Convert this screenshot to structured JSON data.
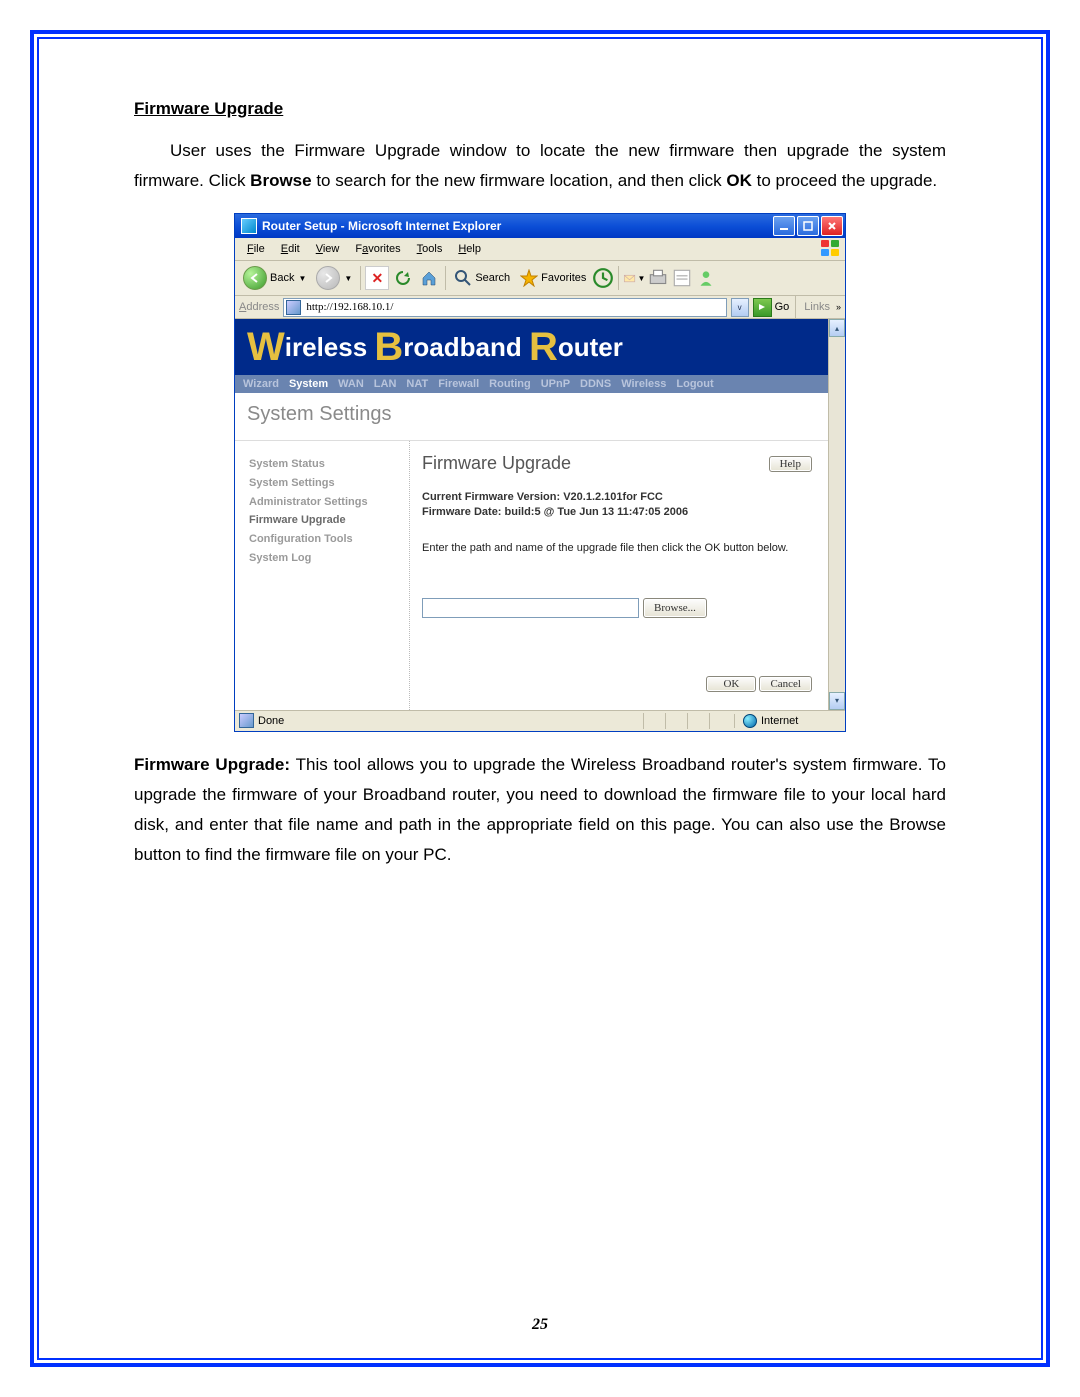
{
  "doc": {
    "section_title": "Firmware Upgrade",
    "para1_a": "User uses the Firmware Upgrade window to locate the new firmware then upgrade the system firmware. Click ",
    "para1_b": "Browse",
    "para1_c": " to search for the new firmware location, and then click ",
    "para1_d": "OK",
    "para1_e": " to proceed the upgrade.",
    "para2_a": "Firmware Upgrade:",
    "para2_b": " This tool allows you to upgrade the Wireless Broadband router's system firmware. To upgrade the firmware of your Broadband router, you need to download the firmware file to your local hard disk, and enter that file name and path in the appropriate field on this page. You can also use the Browse button to find the firmware file on your PC.",
    "page_number": "25"
  },
  "browser": {
    "title": "Router Setup - Microsoft Internet Explorer",
    "menus": [
      "File",
      "Edit",
      "View",
      "Favorites",
      "Tools",
      "Help"
    ],
    "menu_accelerators": [
      "F",
      "E",
      "V",
      "a",
      "T",
      "H"
    ],
    "back": "Back",
    "search": "Search",
    "favorites": "Favorites",
    "address_label": "Address",
    "url": "http://192.168.10.1/",
    "go": "Go",
    "links": "Links",
    "status_done": "Done",
    "status_zone": "Internet"
  },
  "router": {
    "hero_parts": [
      "W",
      "ireless ",
      "B",
      "roadband ",
      "R",
      "outer"
    ],
    "nav": [
      "Wizard",
      "System",
      "WAN",
      "LAN",
      "NAT",
      "Firewall",
      "Routing",
      "UPnP",
      "DDNS",
      "Wireless",
      "Logout"
    ],
    "nav_active_index": 1,
    "section_header": "System Settings",
    "sidebar": [
      "System Status",
      "System Settings",
      "Administrator Settings",
      "Firmware Upgrade",
      "Configuration Tools",
      "System Log"
    ],
    "sidebar_active_index": 3,
    "main_title": "Firmware Upgrade",
    "help": "Help",
    "fw_version_line": "Current Firmware Version: V20.1.2.101for FCC",
    "fw_date_line": "Firmware Date: build:5 @ Tue Jun 13 11:47:05 2006",
    "instruction": "Enter the path and name of the upgrade file then click the OK button below.",
    "browse": "Browse...",
    "ok": "OK",
    "cancel": "Cancel"
  }
}
